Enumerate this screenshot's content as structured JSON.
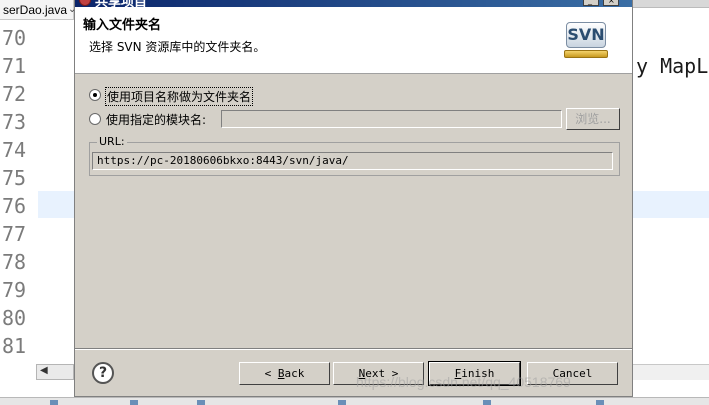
{
  "editor": {
    "tab_label": "serDao.java",
    "tab_close": "⌄",
    "line_numbers": [
      "70",
      "71",
      "72",
      "73",
      "74",
      "75",
      "76",
      "77",
      "78",
      "79",
      "80",
      "81"
    ],
    "code_fragment": "y MapLi"
  },
  "dialog": {
    "title": "共享项目",
    "banner_title": "输入文件夹名",
    "banner_description": "选择 SVN 资源库中的文件夹名。",
    "logo_text": "SVN",
    "options": [
      {
        "label": "使用项目名称做为文件夹名",
        "selected": true
      },
      {
        "label": "使用指定的模块名:",
        "selected": false
      }
    ],
    "module_name_value": "",
    "browse_label": "浏览...",
    "url_group_label": "URL:",
    "url_value": "https://pc-20180606bkxo:8443/svn/java/",
    "help_label": "?",
    "buttons": {
      "back": {
        "prefix": "< ",
        "mnemonic": "B",
        "rest": "ack"
      },
      "next": {
        "mnemonic": "N",
        "rest": "ext >"
      },
      "finish": {
        "mnemonic": "F",
        "rest": "inish"
      },
      "cancel": "Cancel"
    }
  },
  "watermark": "https://blog.csdn.net/qq_40518769",
  "colors": {
    "dialog_bg": "#d4d0c8",
    "titlebar_start": "#0a246a",
    "titlebar_end": "#3a6ea5",
    "current_line_highlight": "#e8f2fe"
  }
}
